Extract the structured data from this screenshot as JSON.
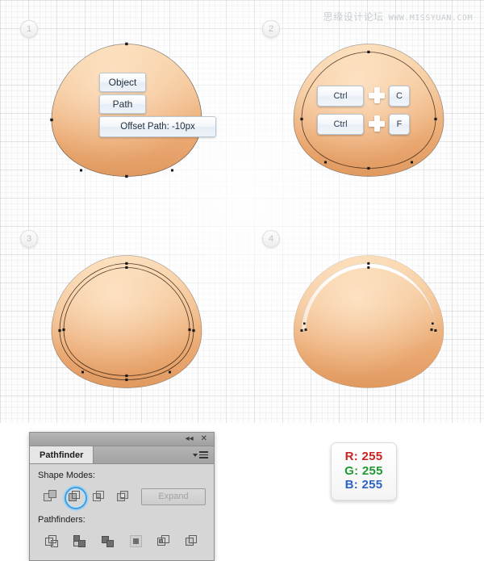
{
  "watermark": {
    "cn": "思缘设计论坛",
    "url": "WWW.MISSYUAN.COM"
  },
  "steps": [
    {
      "number": "1"
    },
    {
      "number": "2"
    },
    {
      "number": "3"
    },
    {
      "number": "4"
    }
  ],
  "panel1": {
    "menu": [
      {
        "label": "Object"
      },
      {
        "label": "Path"
      },
      {
        "label": "Offset Path: -10px"
      }
    ]
  },
  "panel2": {
    "shortcuts": [
      {
        "key1": "Ctrl",
        "plus": "plus-icon",
        "key2": "C"
      },
      {
        "key1": "Ctrl",
        "plus": "plus-icon",
        "key2": "F"
      }
    ]
  },
  "pathfinder": {
    "title": "Pathfinder",
    "collapse_icon": "collapse-double-left-icon",
    "close_icon": "close-icon",
    "menu_icon": "panel-menu-icon",
    "shape_modes_label": "Shape Modes:",
    "shape_modes": [
      {
        "name": "unite",
        "selected": false
      },
      {
        "name": "minus-front",
        "selected": true
      },
      {
        "name": "intersect",
        "selected": false
      },
      {
        "name": "exclude",
        "selected": false
      }
    ],
    "expand_label": "Expand",
    "pathfinders_label": "Pathfinders:",
    "pathfinders": [
      {
        "name": "divide"
      },
      {
        "name": "trim"
      },
      {
        "name": "merge"
      },
      {
        "name": "crop"
      },
      {
        "name": "outline"
      },
      {
        "name": "minus-back"
      }
    ]
  },
  "rgb_card": {
    "lines": [
      {
        "label": "R: 255",
        "color": "#cc2222"
      },
      {
        "label": "G: 255",
        "color": "#1f9a33"
      },
      {
        "label": "B: 255",
        "color": "#2b63c4"
      }
    ]
  },
  "colors": {
    "shape_light": "#f7d0a3",
    "shape_mid": "#efb27f",
    "shape_dark": "#e49a62",
    "accent_blue": "#3f9fe0",
    "panel_gray": "#d6d6d6",
    "canvas": "#fdfdfd"
  }
}
